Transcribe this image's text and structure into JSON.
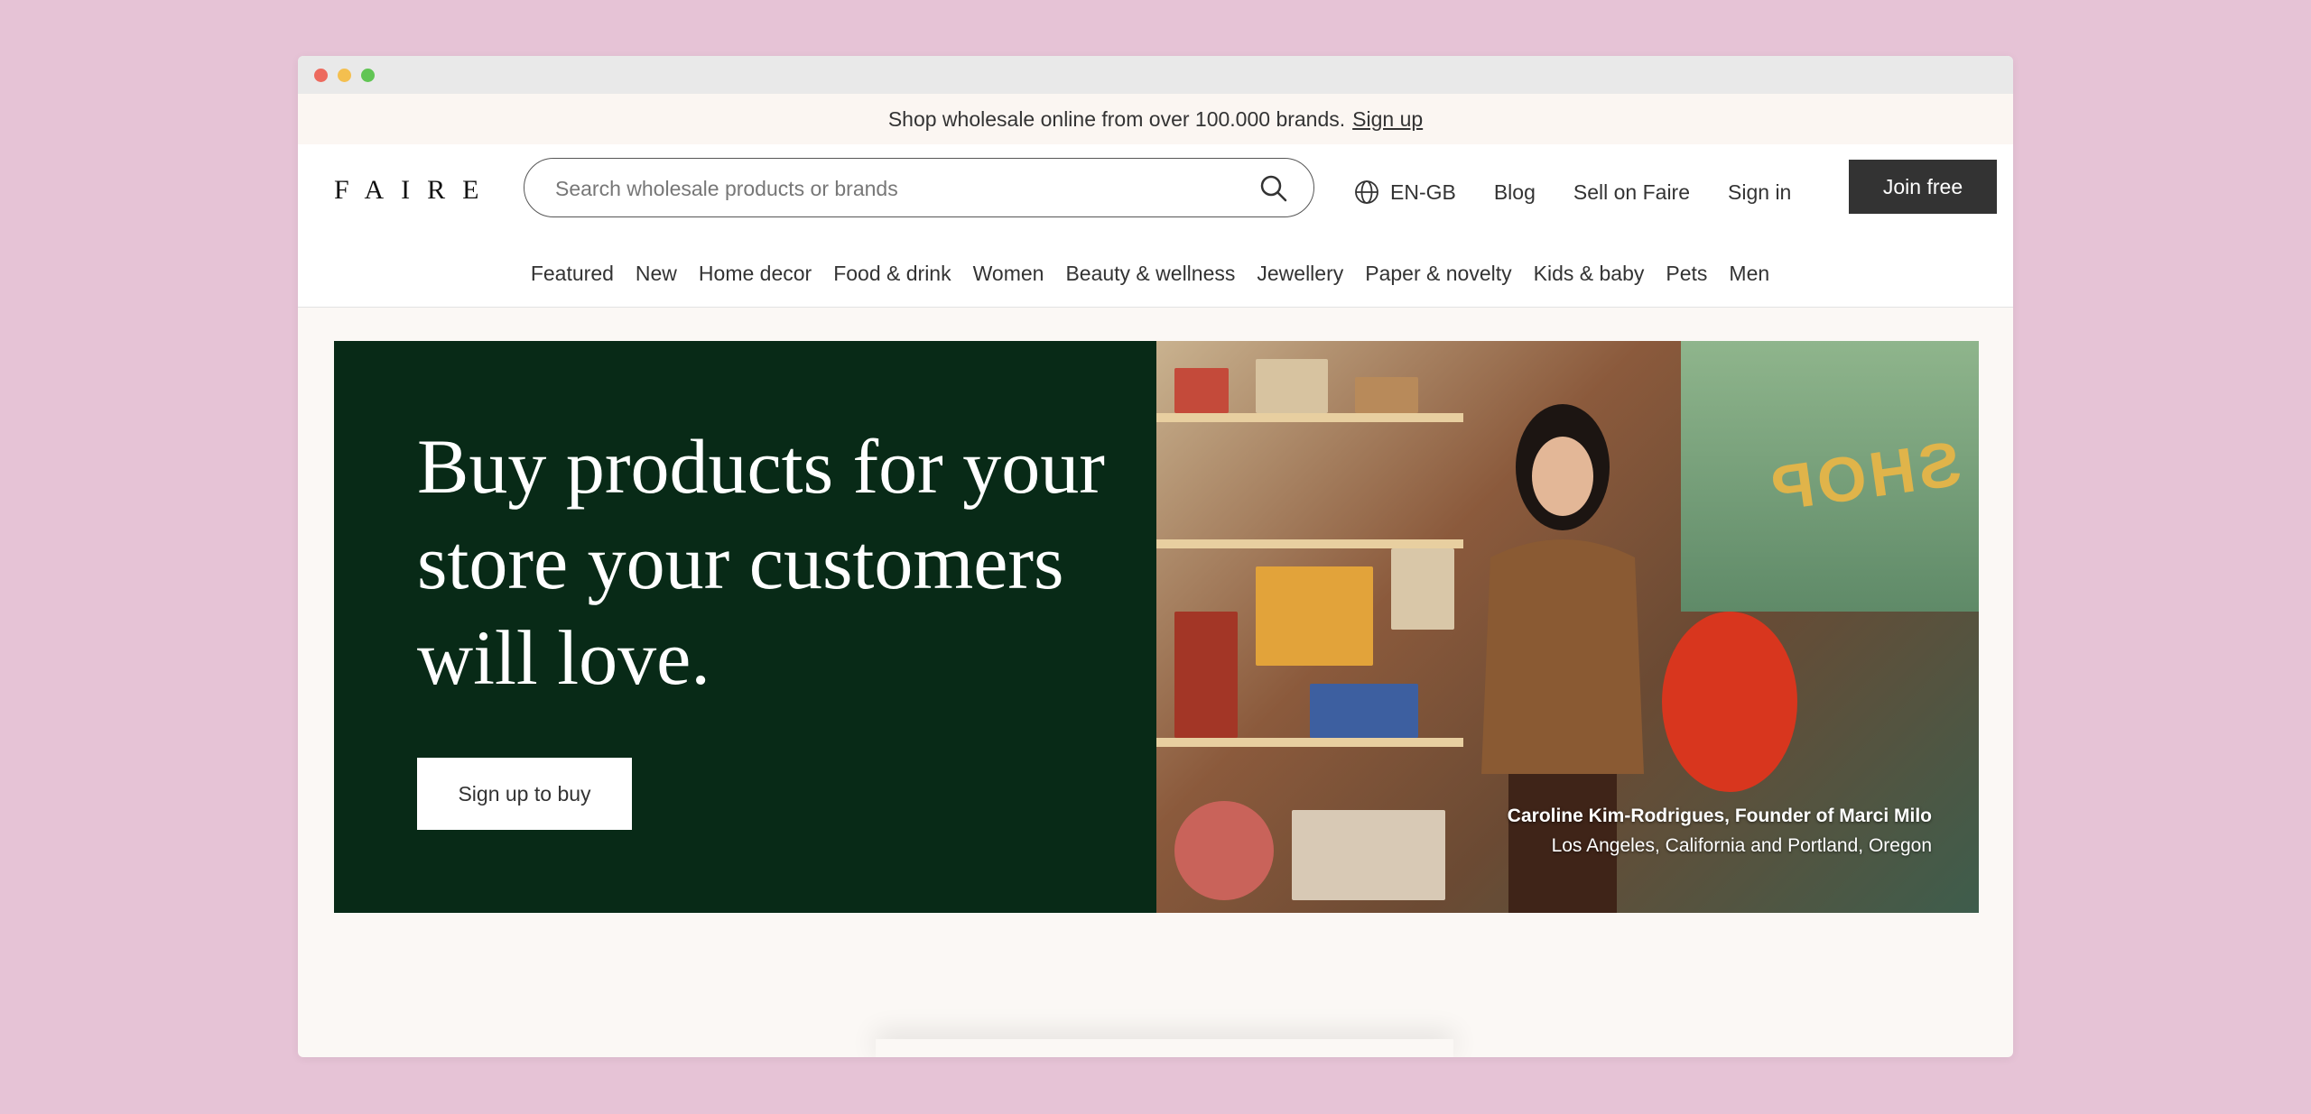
{
  "announcement": {
    "text": "Shop wholesale online from over 100.000 brands.",
    "link": "Sign up"
  },
  "header": {
    "logo": "FAIRE",
    "search_placeholder": "Search wholesale products or brands",
    "language": "EN-GB",
    "links": [
      "Blog",
      "Sell on Faire",
      "Sign in"
    ],
    "join_label": "Join free"
  },
  "categories": [
    "Featured",
    "New",
    "Home decor",
    "Food & drink",
    "Women",
    "Beauty & wellness",
    "Jewellery",
    "Paper & novelty",
    "Kids & baby",
    "Pets",
    "Men"
  ],
  "hero": {
    "headline": "Buy products for your store your customers will love.",
    "cta_label": "Sign up to buy",
    "caption_name": "Caroline Kim-Rodrigues, Founder of Marci Milo",
    "caption_location": "Los Angeles, California and Portland, Oregon",
    "sign_text": "SHOP"
  },
  "colors": {
    "page_bg": "#e6c3d6",
    "hero_green": "#082a17",
    "button_dark": "#333333"
  },
  "icons": [
    "search-icon",
    "globe-icon"
  ]
}
